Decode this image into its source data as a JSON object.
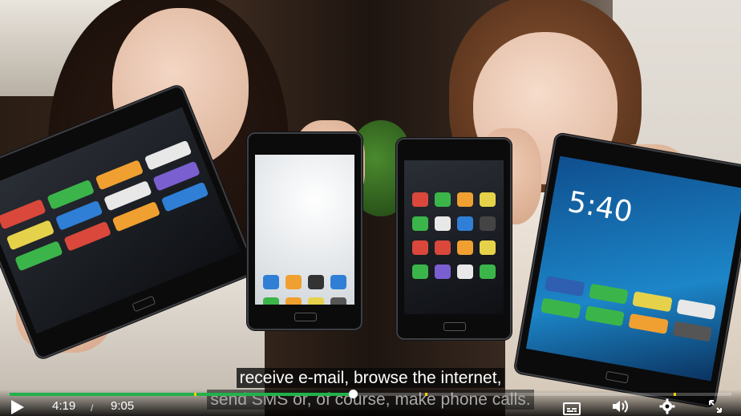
{
  "video": {
    "description_colors": {
      "accent": "#21b24a",
      "marker": "#f5d000"
    }
  },
  "captions": {
    "line1": "receive e-mail, browse the internet,",
    "line2": "send SMS or, of course, make phone calls."
  },
  "controls": {
    "current_time": "4:19",
    "separator": "/",
    "duration": "9:05",
    "progress_fraction": 0.475,
    "marker_fractions": [
      0.255,
      0.575,
      0.92
    ],
    "icons": {
      "play": "play-icon",
      "captions": "captions-icon",
      "volume": "volume-icon",
      "settings": "gear-icon",
      "fullscreen": "fullscreen-icon"
    }
  },
  "phone_screen": {
    "clock": "5:40"
  }
}
